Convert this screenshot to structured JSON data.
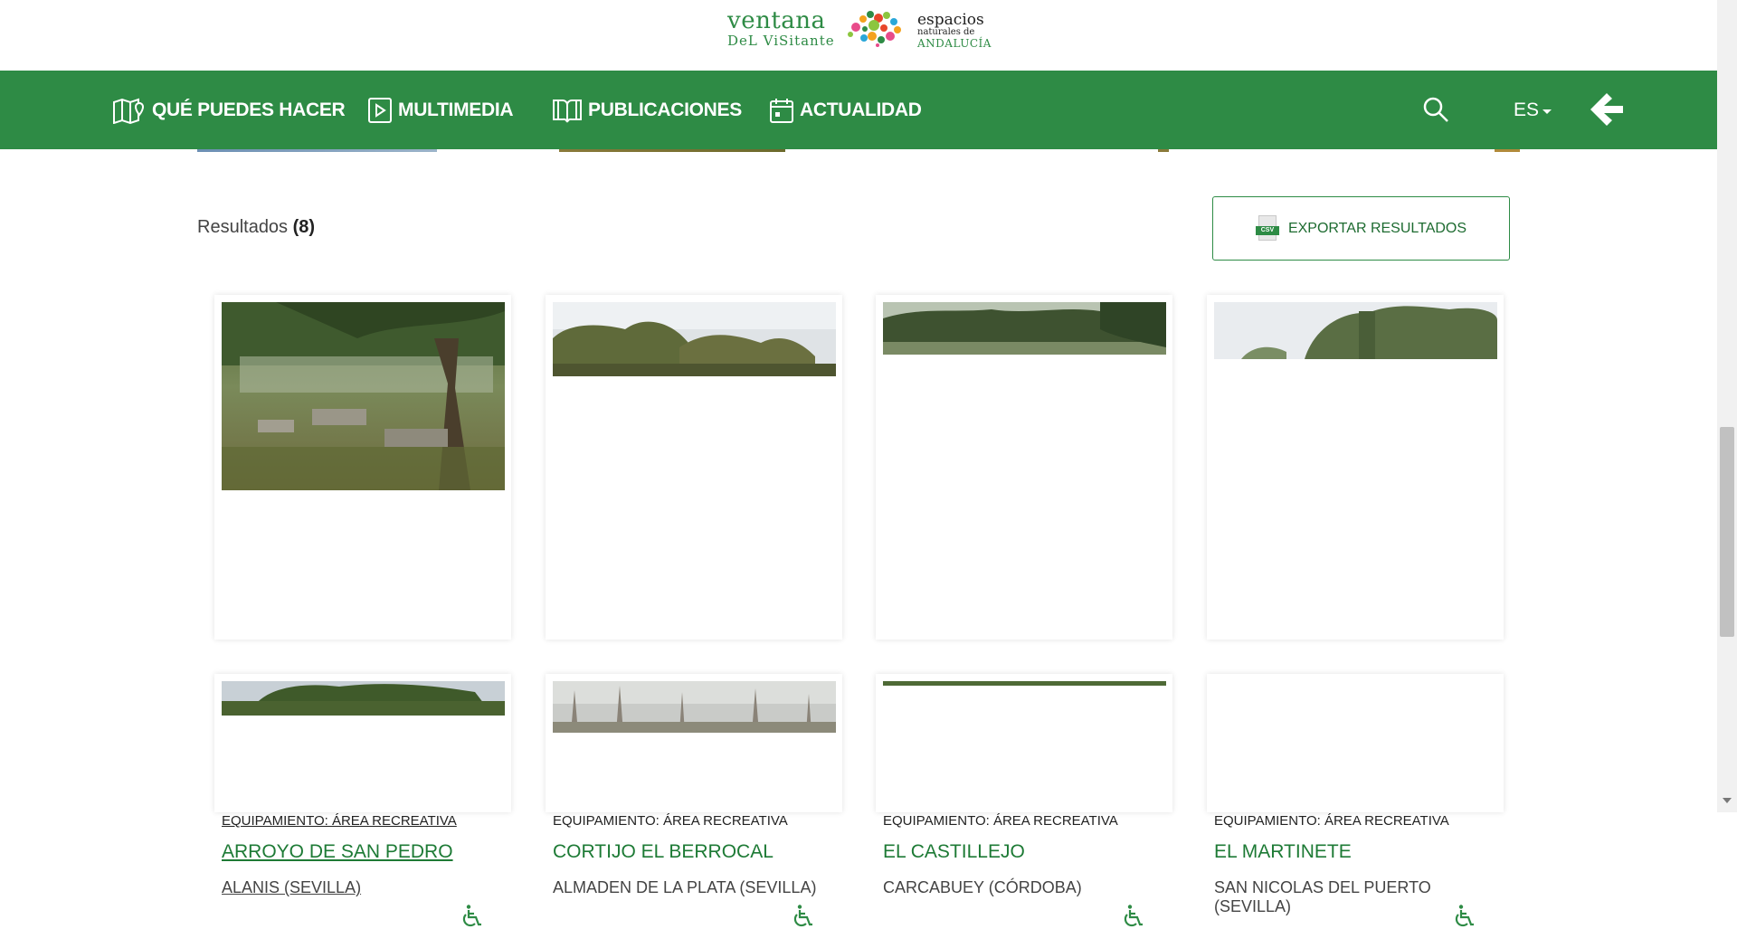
{
  "logo": {
    "line1": "ventana",
    "line2": "DeL ViSitante",
    "right1": "espacios",
    "right2": "naturales de",
    "right3": "ANDALUCÍA"
  },
  "nav": {
    "items": [
      {
        "label": "QUÉ PUEDES HACER",
        "icon": "map-pin-icon"
      },
      {
        "label": "MULTIMEDIA",
        "icon": "play-icon"
      },
      {
        "label": "PUBLICACIONES",
        "icon": "book-icon"
      },
      {
        "label": "ACTUALIDAD",
        "icon": "calendar-icon"
      }
    ],
    "language": "ES",
    "search_icon": "search-icon",
    "back_icon": "arrow-left-icon",
    "color": "#2e8b45"
  },
  "results": {
    "label": "Resultados",
    "count": "(8)"
  },
  "export": {
    "icon_text": "CSV",
    "label": "EXPORTAR RESULTADOS"
  },
  "cards": [
    {
      "category": "EQUIPAMIENTO: ÁREA RECREATIVA",
      "title": "ARROYO DE SAN PEDRO",
      "location": "ALANIS (SEVILLA)",
      "accessible": true
    },
    {
      "category": "EQUIPAMIENTO: ÁREA RECREATIVA",
      "title": "CORTIJO EL BERROCAL",
      "location": "ALMADEN DE LA PLATA (SEVILLA)",
      "accessible": true
    },
    {
      "category": "EQUIPAMIENTO: ÁREA RECREATIVA",
      "title": "EL CASTILLEJO",
      "location": "CARCABUEY (CÓRDOBA)",
      "accessible": true
    },
    {
      "category": "EQUIPAMIENTO: ÁREA RECREATIVA",
      "title": "EL MARTINETE",
      "location": "SAN NICOLAS DEL PUERTO (SEVILLA)",
      "accessible": true
    }
  ],
  "colors": {
    "accent": "#2e8b45",
    "title_green": "#1d7a35"
  }
}
